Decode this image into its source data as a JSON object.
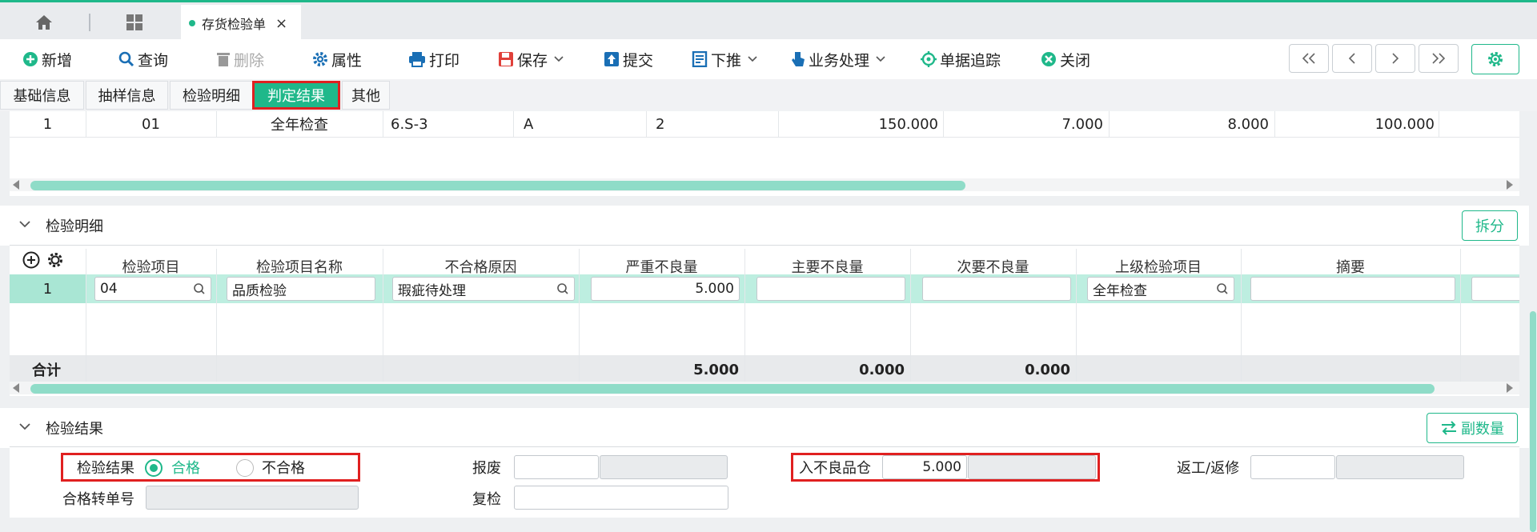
{
  "tabs": {
    "doc_tab_label": "存货检验单",
    "close_glyph": "×"
  },
  "toolbar": {
    "new": "新增",
    "query": "查询",
    "delete": "删除",
    "props": "属性",
    "print": "打印",
    "save": "保存",
    "submit": "提交",
    "push": "下推",
    "business": "业务处理",
    "trace": "单据追踪",
    "close": "关闭"
  },
  "subtabs": [
    "基础信息",
    "抽样信息",
    "检验明细",
    "判定结果",
    "其他"
  ],
  "active_subtab": "判定结果",
  "top_table": {
    "row": [
      "1",
      "01",
      "全年检查",
      "6.S-3",
      "A",
      "2",
      "150.000",
      "7.000",
      "8.000",
      "100.000"
    ]
  },
  "detail_section": {
    "title": "检验明细",
    "split_button": "拆分",
    "columns": [
      "检验项目",
      "检验项目名称",
      "不合格原因",
      "严重不良量",
      "主要不良量",
      "次要不良量",
      "上级检验项目",
      "摘要"
    ],
    "row": {
      "index": "1",
      "item": "04",
      "item_name": "品质检验",
      "reason": "瑕疵待处理",
      "severe": "5.000",
      "major": "",
      "minor": "",
      "parent_item": "全年检查",
      "summary": ""
    },
    "total": {
      "label": "合计",
      "severe": "5.000",
      "major": "0.000",
      "minor": "0.000"
    }
  },
  "result_section": {
    "title": "检验结果",
    "sub_qty_button": "副数量",
    "result_label": "检验结果",
    "option_pass": "合格",
    "option_fail": "不合格",
    "selected": "合格",
    "scrap_label": "报废",
    "defect_wh_label": "入不良品仓",
    "defect_wh_value": "5.000",
    "rework_label": "返工/返修",
    "pass_doc_label": "合格转单号",
    "recheck_label": "复检"
  },
  "colors": {
    "accent": "#1fb88a",
    "highlight": "#e02020",
    "row_selected": "#bdeee0"
  }
}
